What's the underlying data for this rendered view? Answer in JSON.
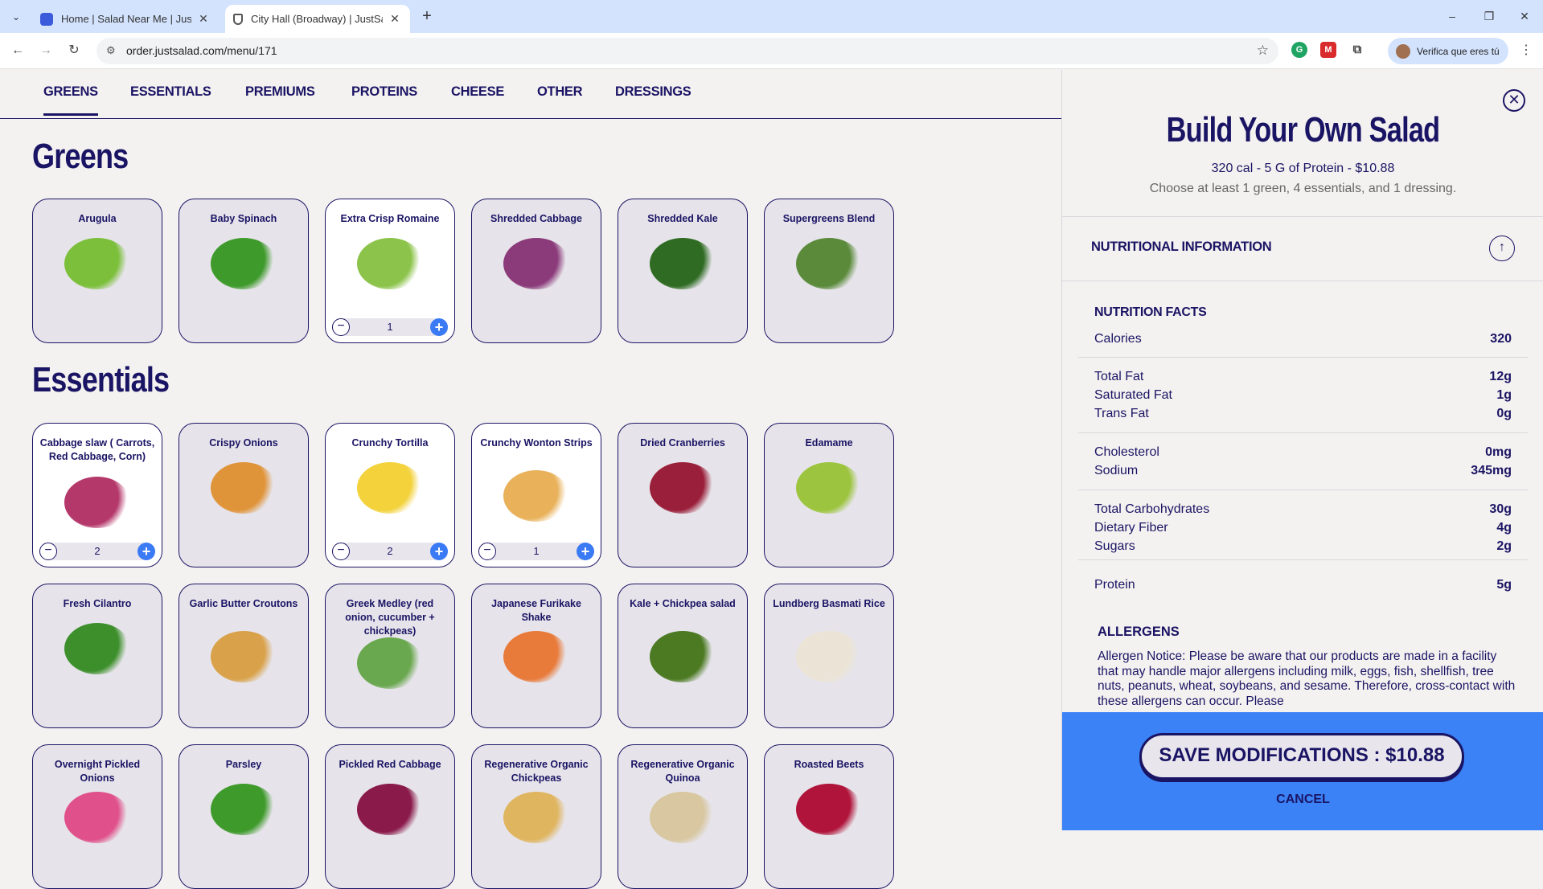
{
  "browser": {
    "tabs": [
      {
        "title": "Home | Salad Near Me | Just Sa"
      },
      {
        "title": "City Hall (Broadway) | JustSalad"
      }
    ],
    "new_tab_symbol": "+",
    "url": "order.justsalad.com/menu/171",
    "profile_label": "Verifica que eres tú",
    "window_controls": {
      "minimize": "–",
      "restore": "❐",
      "close": "✕"
    }
  },
  "category_nav": [
    "GREENS",
    "ESSENTIALS",
    "PREMIUMS",
    "PROTEINS",
    "CHEESE",
    "OTHER",
    "DRESSINGS"
  ],
  "sections": {
    "greens_title": "Greens",
    "essentials_title": "Essentials"
  },
  "greens": [
    {
      "name": "Arugula",
      "color": "#7bbf3a"
    },
    {
      "name": "Baby Spinach",
      "color": "#3f9a2c"
    },
    {
      "name": "Extra Crisp Romaine",
      "color": "#8cc34a",
      "qty": "1"
    },
    {
      "name": "Shredded Cabbage",
      "color": "#8b3a7a"
    },
    {
      "name": "Shredded Kale",
      "color": "#2f6b22"
    },
    {
      "name": "Supergreens Blend",
      "color": "#5a8a3a"
    }
  ],
  "essentials": [
    {
      "name": "Cabbage slaw ( Carrots, Red Cabbage, Corn)",
      "color": "#b5386b",
      "qty": "2"
    },
    {
      "name": "Crispy Onions",
      "color": "#e0943a"
    },
    {
      "name": "Crunchy Tortilla",
      "color": "#f3d23c",
      "qty": "2"
    },
    {
      "name": "Crunchy Wonton Strips",
      "color": "#e8b15a",
      "qty": "1"
    },
    {
      "name": "Dried Cranberries",
      "color": "#9a1f3a"
    },
    {
      "name": "Edamame",
      "color": "#9cc43e"
    },
    {
      "name": "Fresh Cilantro",
      "color": "#3d8f2c"
    },
    {
      "name": "Garlic Butter Croutons",
      "color": "#d9a24a"
    },
    {
      "name": "Greek Medley (red onion, cucumber + chickpeas)",
      "color": "#6aa84f"
    },
    {
      "name": "Japanese Furikake Shake",
      "color": "#e87a3a"
    },
    {
      "name": "Kale + Chickpea salad",
      "color": "#4c7a22"
    },
    {
      "name": "Lundberg Basmati Rice",
      "color": "#ebe4d6"
    },
    {
      "name": "Overnight Pickled Onions",
      "color": "#e0508a"
    },
    {
      "name": "Parsley",
      "color": "#3f9a2c"
    },
    {
      "name": "Pickled Red Cabbage",
      "color": "#8a1a4a"
    },
    {
      "name": "Regenerative Organic Chickpeas",
      "color": "#e0b560"
    },
    {
      "name": "Regenerative Organic Quinoa",
      "color": "#d8c7a0"
    },
    {
      "name": "Roasted Beets",
      "color": "#b0143a"
    }
  ],
  "stepper": {
    "minus": "−",
    "plus": "+"
  },
  "panel": {
    "close": "✕",
    "title": "Build Your Own Salad",
    "summary": "320 cal  -  5 G of Protein  -  $10.88",
    "note": "Choose at least 1 green, 4 essentials, and 1 dressing.",
    "nutrition_header": "NUTRITIONAL INFORMATION",
    "toggle_arrow": "↑",
    "facts_header": "NUTRITION FACTS",
    "facts": [
      {
        "label": "Calories",
        "value": "320"
      },
      {
        "label": "Total Fat",
        "value": "12g"
      },
      {
        "label": "Saturated Fat",
        "value": "1g"
      },
      {
        "label": "Trans Fat",
        "value": "0g"
      },
      {
        "label": "Cholesterol",
        "value": "0mg"
      },
      {
        "label": "Sodium",
        "value": "345mg"
      },
      {
        "label": "Total Carbohydrates",
        "value": "30g"
      },
      {
        "label": "Dietary Fiber",
        "value": "4g"
      },
      {
        "label": "Sugars",
        "value": "2g"
      },
      {
        "label": "Protein",
        "value": "5g"
      }
    ],
    "allergens_header": "ALLERGENS",
    "allergens_text": "Allergen Notice: Please be aware that our products are made in a facility that may handle major allergens including milk, eggs, fish, shellfish, tree nuts, peanuts, wheat, soybeans, and sesame. Therefore, cross-contact with these allergens can occur. Please",
    "save_label": "SAVE MODIFICATIONS : $10.88",
    "cancel_label": "CANCEL"
  },
  "colors": {
    "navy": "#1a1464",
    "blue": "#3b82f6",
    "card": "#e6e4ea",
    "background": "#f4f2f0"
  }
}
